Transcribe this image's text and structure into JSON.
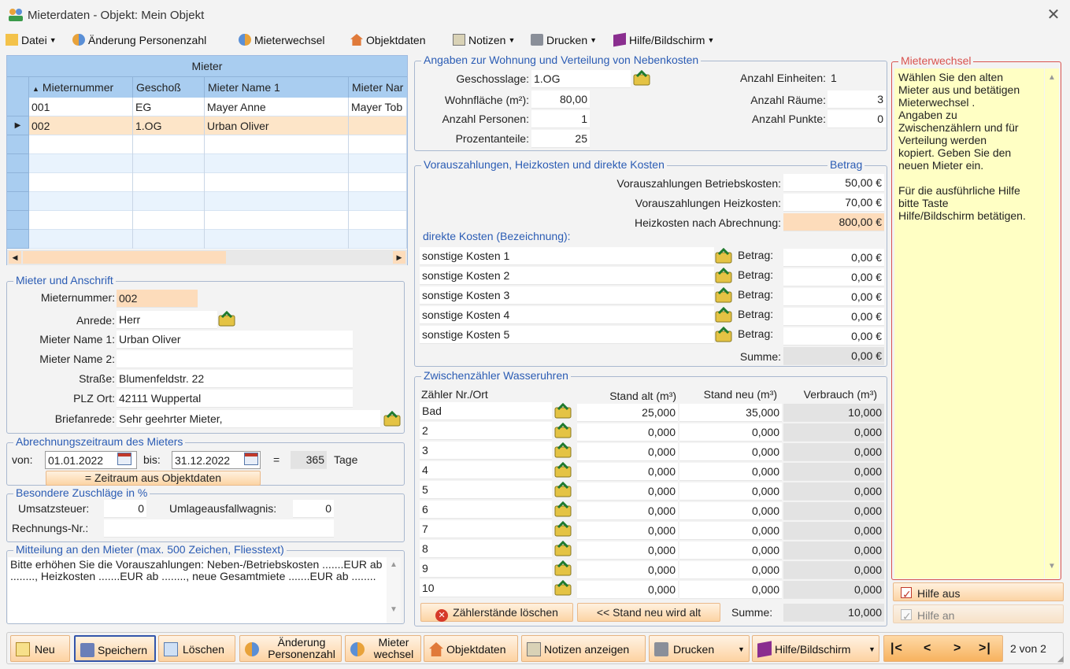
{
  "window": {
    "title": "Mieterdaten - Objekt: Mein Objekt"
  },
  "menu": [
    "Datei",
    "Änderung Personenzahl",
    "Mieterwechsel",
    "Objektdaten",
    "Notizen",
    "Drucken",
    "Hilfe/Bildschirm"
  ],
  "grid": {
    "title": "Mieter",
    "columns": [
      "Mieternummer",
      "Geschoß",
      "Mieter Name 1",
      "Mieter Nar"
    ],
    "rows": [
      [
        "001",
        "EG",
        "Mayer Anne",
        "Mayer Tob"
      ],
      [
        "002",
        "1.OG",
        "Urban Oliver",
        ""
      ]
    ]
  },
  "anschrift": {
    "legend": "Mieter und Anschrift",
    "labels": {
      "nr": "Mieternummer:",
      "anrede": "Anrede:",
      "name1": "Mieter Name 1:",
      "name2": "Mieter Name 2:",
      "strasse": "Straße:",
      "plz": "PLZ Ort:",
      "brief": "Briefanrede:"
    },
    "values": {
      "nr": "002",
      "anrede": "Herr",
      "name1": "Urban Oliver",
      "name2": "",
      "strasse": "Blumenfeldstr. 22",
      "plz": "42111 Wuppertal",
      "brief": "Sehr geehrter Mieter,"
    }
  },
  "zeitraum": {
    "legend": "Abrechnungszeitraum des Mieters",
    "von_label": "von:",
    "von": "01.01.2022",
    "bis_label": "bis:",
    "bis": "31.12.2022",
    "eq": "=",
    "tage": "365",
    "tage_label": "Tage",
    "button": "= Zeitraum aus Objektdaten"
  },
  "zuschlaege": {
    "legend": "Besondere Zuschläge in %",
    "ust_label": "Umsatzsteuer:",
    "ust": "0",
    "umlage_label": "Umlageausfallwagnis:",
    "umlage": "0",
    "rechnung_label": "Rechnungs-Nr.:",
    "rechnung": ""
  },
  "mitteilung": {
    "legend": "Mitteilung an den Mieter (max. 500 Zeichen, Fliesstext)",
    "text": "Bitte erhöhen Sie die Vorauszahlungen: Neben-/Betriebskosten .......EUR ab ........, Heizkosten .......EUR ab ........, neue Gesamtmiete .......EUR ab ........"
  },
  "wohnung": {
    "legend": "Angaben zur Wohnung und Verteilung von Nebenkosten",
    "geschoss_label": "Geschosslage:",
    "geschoss": "1.OG",
    "flaeche_label": "Wohnfläche (m²):",
    "flaeche": "80,00",
    "personen_label": "Anzahl Personen:",
    "personen": "1",
    "prozent_label": "Prozentanteile:",
    "prozent": "25",
    "einheiten_label": "Anzahl Einheiten:",
    "einheiten": "1",
    "raeume_label": "Anzahl Räume:",
    "raeume": "3",
    "punkte_label": "Anzahl Punkte:",
    "punkte": "0"
  },
  "kosten": {
    "legend": "Vorauszahlungen, Heizkosten und direkte Kosten",
    "betrag_hdr": "Betrag",
    "rows": [
      {
        "label": "Vorauszahlungen Betriebskosten:",
        "value": "50,00 €"
      },
      {
        "label": "Vorauszahlungen Heizkosten:",
        "value": "70,00 €"
      },
      {
        "label": "Heizkosten nach Abrechnung:",
        "value": "800,00 €"
      }
    ],
    "direkt_label": "direkte Kosten (Bezeichnung):",
    "betrag_label": "Betrag:",
    "direkt": [
      {
        "name": "sonstige Kosten 1",
        "value": "0,00 €"
      },
      {
        "name": "sonstige Kosten 2",
        "value": "0,00 €"
      },
      {
        "name": "sonstige Kosten 3",
        "value": "0,00 €"
      },
      {
        "name": "sonstige Kosten 4",
        "value": "0,00 €"
      },
      {
        "name": "sonstige Kosten 5",
        "value": "0,00 €"
      }
    ],
    "summe_label": "Summe:",
    "summe": "0,00 €"
  },
  "zaehler": {
    "legend": "Zwischenzähler Wasseruhren",
    "headers": [
      "Zähler Nr./Ort",
      "Stand alt (m³)",
      "Stand neu (m³)",
      "Verbrauch (m³)"
    ],
    "rows": [
      [
        "Bad",
        "25,000",
        "35,000",
        "10,000"
      ],
      [
        "2",
        "0,000",
        "0,000",
        "0,000"
      ],
      [
        "3",
        "0,000",
        "0,000",
        "0,000"
      ],
      [
        "4",
        "0,000",
        "0,000",
        "0,000"
      ],
      [
        "5",
        "0,000",
        "0,000",
        "0,000"
      ],
      [
        "6",
        "0,000",
        "0,000",
        "0,000"
      ],
      [
        "7",
        "0,000",
        "0,000",
        "0,000"
      ],
      [
        "8",
        "0,000",
        "0,000",
        "0,000"
      ],
      [
        "9",
        "0,000",
        "0,000",
        "0,000"
      ],
      [
        "10",
        "0,000",
        "0,000",
        "0,000"
      ]
    ],
    "btn_loeschen": "Zählerstände löschen",
    "btn_alt": "<< Stand neu wird alt",
    "summe_label": "Summe:",
    "summe": "10,000"
  },
  "hilfe": {
    "legend": "Mieterwechsel",
    "text": "Wählen Sie den alten\nMieter aus und betätigen\nMieterwechsel .\nAngaben zu\nZwischenzählern und für\nVerteilung werden\nkopiert. Geben Sie den\nneuen Mieter ein.\n\nFür die ausführliche Hilfe\nbitte Taste\nHilfe/Bildschirm betätigen.",
    "aus": "Hilfe aus",
    "an": "Hilfe an"
  },
  "toolbar": {
    "neu": "Neu",
    "speichern": "Speichern",
    "loeschen": "Löschen",
    "aenderung1": "Änderung",
    "aenderung2": "Personenzahl",
    "wechsel1": "Mieter",
    "wechsel2": "wechsel",
    "objekt": "Objektdaten",
    "notizen": "Notizen anzeigen",
    "drucken": "Drucken",
    "hilfe": "Hilfe/Bildschirm",
    "first": "|<",
    "prev": "<",
    "next": ">",
    "last": ">|",
    "pos": "2 von 2"
  }
}
